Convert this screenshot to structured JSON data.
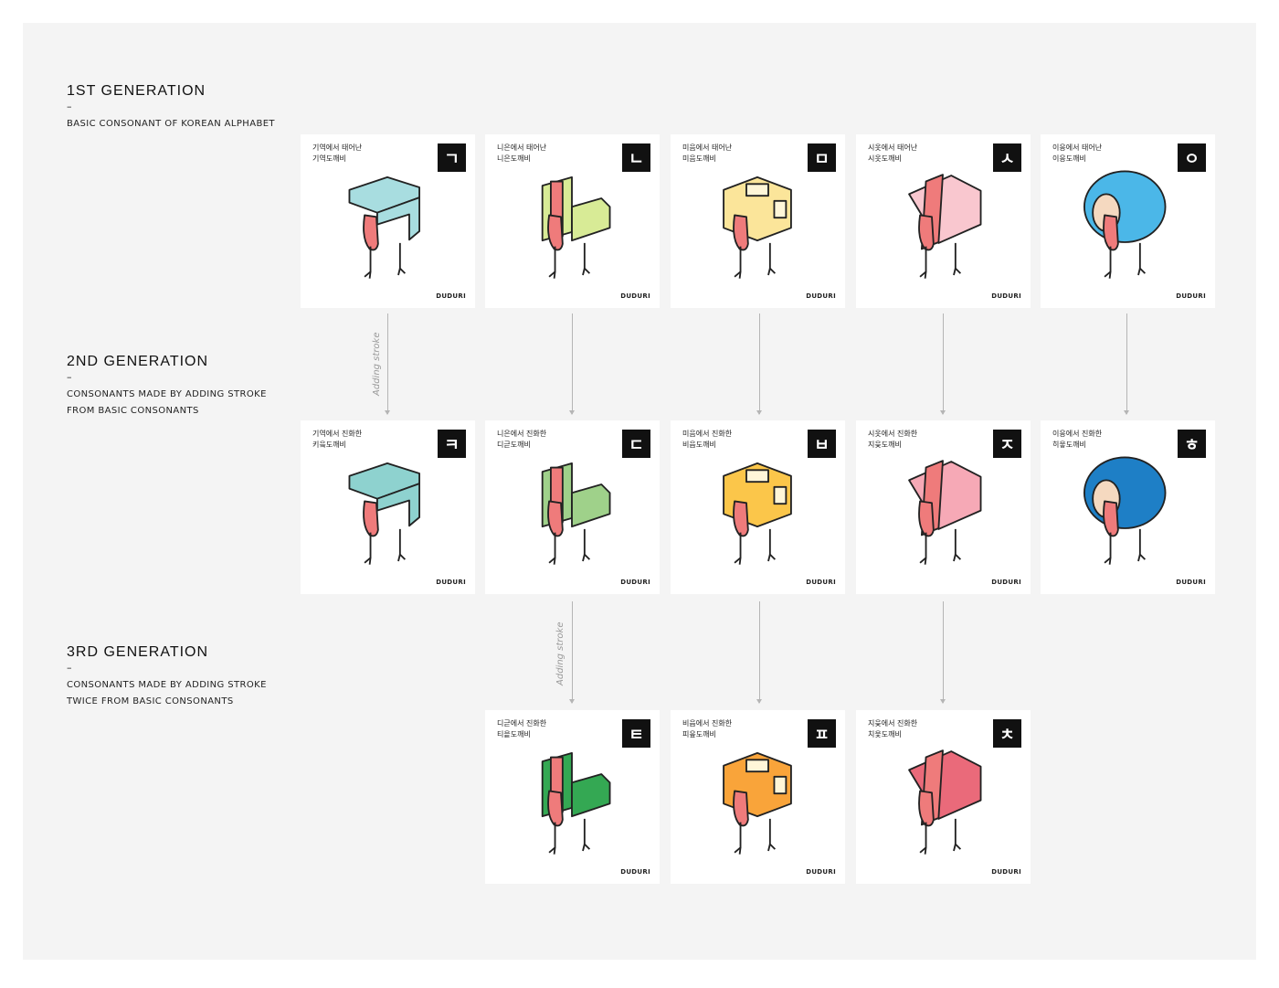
{
  "generations": [
    {
      "title": "1ST GENERATION",
      "dash": "–",
      "desc": [
        "BASIC CONSONANT OF KOREAN ALPHABET"
      ]
    },
    {
      "title": "2ND GENERATION",
      "dash": "–",
      "desc": [
        "CONSONANTS MADE BY ADDING STROKE",
        "FROM BASIC CONSONANTS"
      ]
    },
    {
      "title": "3RD GENERATION",
      "dash": "–",
      "desc": [
        "CONSONANTS MADE BY ADDING STROKE",
        "TWICE FROM BASIC CONSONANTS"
      ]
    }
  ],
  "connector_label": "Adding stroke",
  "brand": "DUDURI",
  "cards": [
    {
      "caption": [
        "기역에서 태어난",
        "기역도깨비"
      ],
      "glyph": "ㄱ",
      "color": "#a8dde0",
      "icon": "giyeok-goblin-icon"
    },
    {
      "caption": [
        "니은에서 태어난",
        "니은도깨비"
      ],
      "glyph": "ㄴ",
      "color": "#d8eb96",
      "icon": "nieun-goblin-icon"
    },
    {
      "caption": [
        "미음에서 태어난",
        "미음도깨비"
      ],
      "glyph": "ㅁ",
      "color": "#fbe59a",
      "icon": "mieum-goblin-icon"
    },
    {
      "caption": [
        "시옷에서 태어난",
        "시옷도깨비"
      ],
      "glyph": "ㅅ",
      "color": "#f9c7cf",
      "icon": "siot-goblin-icon"
    },
    {
      "caption": [
        "이응에서 태어난",
        "이응도깨비"
      ],
      "glyph": "ㅇ",
      "color": "#4bb7e8",
      "icon": "ieung-goblin-icon"
    },
    {
      "caption": [
        "기역에서 진화한",
        "키읔도깨비"
      ],
      "glyph": "ㅋ",
      "color": "#8ed2cf",
      "icon": "kieuk-goblin-icon"
    },
    {
      "caption": [
        "니은에서 진화한",
        "디귿도깨비"
      ],
      "glyph": "ㄷ",
      "color": "#9fd18a",
      "icon": "digeut-goblin-icon"
    },
    {
      "caption": [
        "미음에서 진화한",
        "비읍도깨비"
      ],
      "glyph": "ㅂ",
      "color": "#fbc64a",
      "icon": "bieup-goblin-icon"
    },
    {
      "caption": [
        "시옷에서 진화한",
        "지읒도깨비"
      ],
      "glyph": "ㅈ",
      "color": "#f6a9b6",
      "icon": "jieut-goblin-icon"
    },
    {
      "caption": [
        "이응에서 진화한",
        "히읗도깨비"
      ],
      "glyph": "ㅎ",
      "color": "#1e7fc6",
      "icon": "hieut-goblin-icon"
    },
    {
      "caption": [
        "디귿에서 진화한",
        "티읕도깨비"
      ],
      "glyph": "ㅌ",
      "color": "#34a853",
      "icon": "tieut-goblin-icon"
    },
    {
      "caption": [
        "비읍에서 진화한",
        "피읖도깨비"
      ],
      "glyph": "ㅍ",
      "color": "#f9a43a",
      "icon": "pieup-goblin-icon"
    },
    {
      "caption": [
        "지읒에서 진화한",
        "치읓도깨비"
      ],
      "glyph": "ㅊ",
      "color": "#ea6a7a",
      "icon": "chieut-goblin-icon"
    }
  ]
}
